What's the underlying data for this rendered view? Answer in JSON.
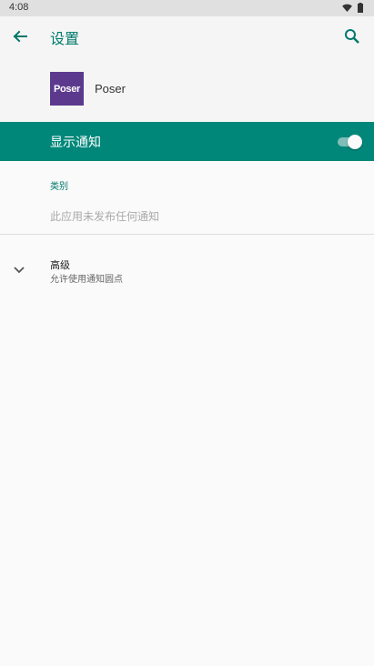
{
  "status_bar": {
    "time": "4:08",
    "icons": [
      "wifi-icon",
      "battery-icon"
    ]
  },
  "toolbar": {
    "title": "设置",
    "back_icon": "arrow-left-icon",
    "search_icon": "search-icon"
  },
  "app": {
    "name": "Poser",
    "icon_text": "Poser",
    "icon_color": "#5b3a8e"
  },
  "notifications": {
    "label": "显示通知",
    "enabled": true,
    "bar_color": "#00877a"
  },
  "category": {
    "header": "类别",
    "empty_message": "此应用未发布任何通知"
  },
  "advanced": {
    "title": "高级",
    "summary": "允许使用通知圆点",
    "icon": "chevron-down-icon"
  },
  "colors": {
    "accent": "#00796b",
    "background": "#fafafa"
  }
}
